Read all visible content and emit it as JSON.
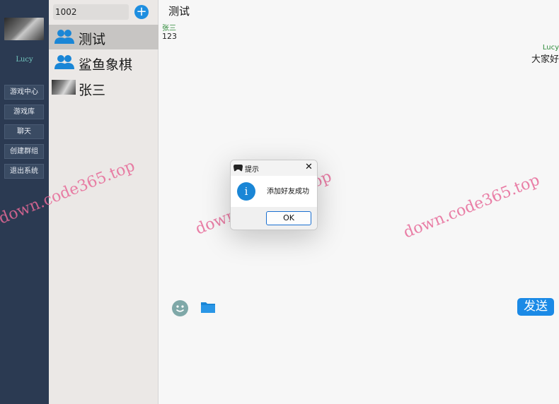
{
  "user": {
    "name": "Lucy"
  },
  "nav": {
    "items": [
      {
        "label": "游戏中心"
      },
      {
        "label": "游戏库"
      },
      {
        "label": "聊天"
      },
      {
        "label": "创建群组"
      },
      {
        "label": "退出系统"
      }
    ]
  },
  "contacts": {
    "search_value": "1002",
    "add_label": "+",
    "items": [
      {
        "name": "测试",
        "icon": "group-icon",
        "selected": true
      },
      {
        "name": "鲨鱼象棋",
        "icon": "group-icon",
        "selected": false
      },
      {
        "name": "张三",
        "icon": "photo-avatar",
        "selected": false
      }
    ]
  },
  "chat": {
    "title": "测试",
    "messages": [
      {
        "sender": "张三",
        "text": "123",
        "side": "left"
      },
      {
        "sender": "Lucy",
        "text": "大家好",
        "side": "right"
      }
    ],
    "send_label": "发送"
  },
  "watermark": "down.code365.top",
  "dialog": {
    "title": "提示",
    "close_glyph": "✕",
    "message": "添加好友成功",
    "info_glyph": "i",
    "ok_label": "OK"
  },
  "colors": {
    "nav_bg": "#2b3a52",
    "accent": "#1b8ae6",
    "watermark": "#e76a98"
  }
}
